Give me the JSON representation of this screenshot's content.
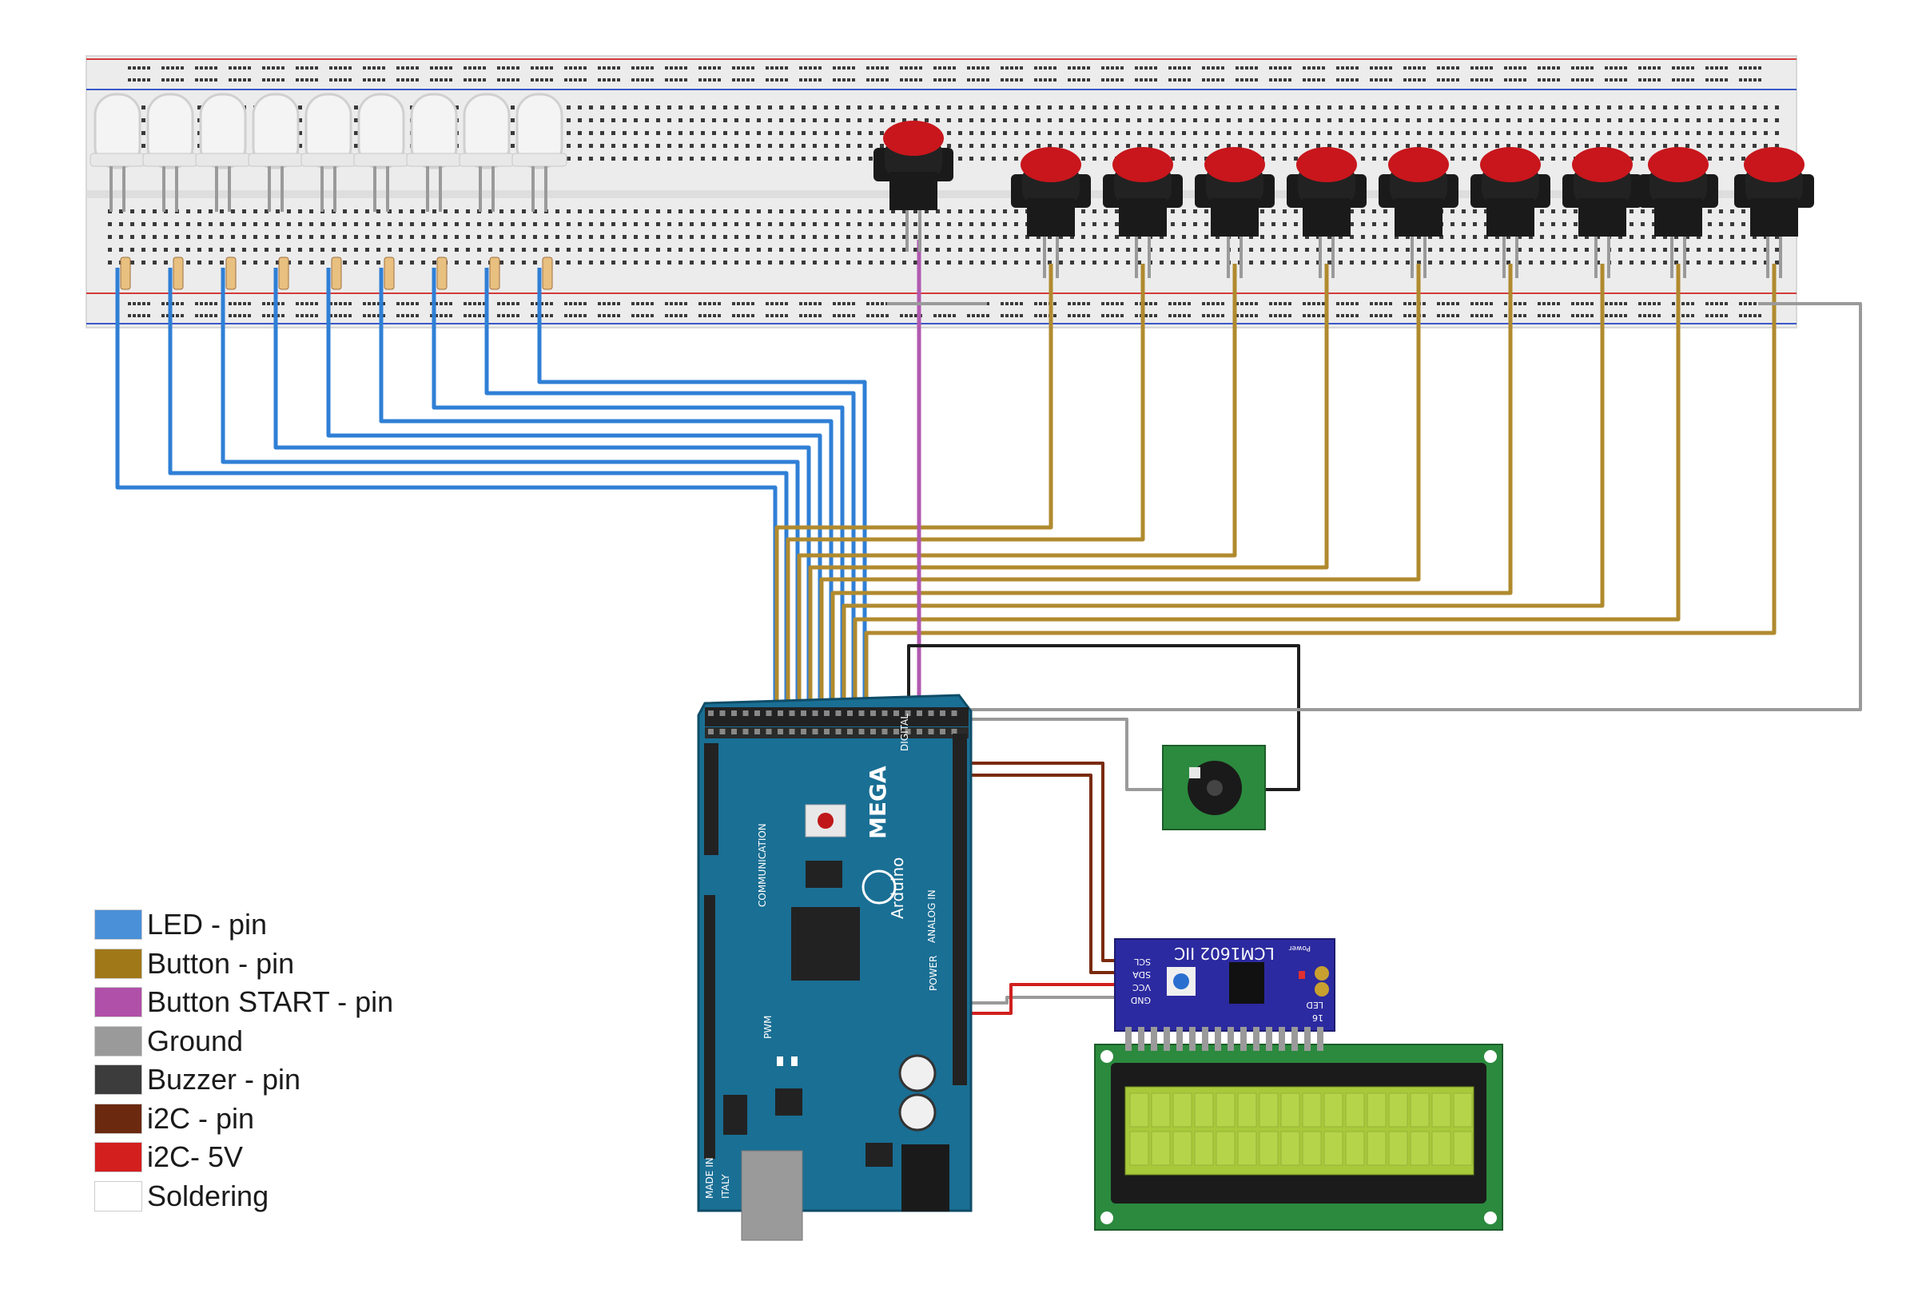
{
  "legend": [
    {
      "label": "LED - pin",
      "color": "#4a90d9"
    },
    {
      "label": "Button - pin",
      "color": "#a07818"
    },
    {
      "label": "Button START - pin",
      "color": "#b050a8"
    },
    {
      "label": "Ground",
      "color": "#9a9a9a"
    },
    {
      "label": "Buzzer - pin",
      "color": "#3c3c3c"
    },
    {
      "label": "i2C - pin",
      "color": "#6b2a10"
    },
    {
      "label": "i2C- 5V",
      "color": "#d41f1f"
    },
    {
      "label": "Soldering",
      "color": "#ffffff"
    }
  ],
  "arduino": {
    "brand": "Arduino",
    "model": "MEGA",
    "made_in": "MADE IN",
    "country": "ITALY",
    "header_digital": "DIGITAL",
    "header_pwm": "PWM",
    "header_analog": "ANALOG IN",
    "header_power": "POWER",
    "header_communication": "COMMUNICATION"
  },
  "i2c_module": {
    "title": "LCM1602 IIC",
    "pins": [
      "SCL",
      "SDA",
      "VCC",
      "GND"
    ],
    "led_label": "LED",
    "power_label": "Power",
    "pin16": "16"
  },
  "counts": {
    "leds": 9,
    "buttons": 9
  },
  "colors": {
    "led_wire": "#2f7fd6",
    "button_wire": "#b08a2e",
    "start_wire": "#b05aaf",
    "ground_wire": "#9a9a9a",
    "buzzer_wire": "#1e1e1e",
    "i2c_wire": "#7a2a0e",
    "i2c_5v": "#d0201e",
    "board_blue": "#1a6f94",
    "button_red": "#c8161c",
    "lcd_green": "#a8c93a",
    "pcb_green": "#2b8a3e",
    "module_blue": "#2c2aa0"
  }
}
